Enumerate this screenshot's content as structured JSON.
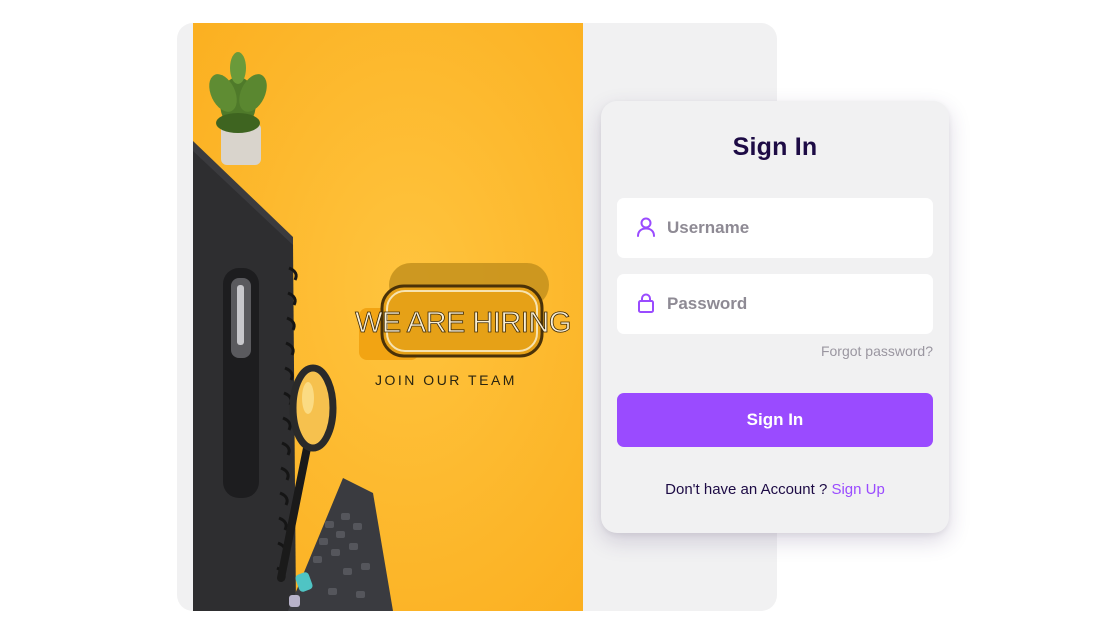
{
  "hero": {
    "headline": "WE ARE HIRING",
    "tagline": "JOIN OUR TEAM"
  },
  "login": {
    "title": "Sign In",
    "username_placeholder": "Username",
    "password_placeholder": "Password",
    "forgot_label": "Forgot password?",
    "submit_label": "Sign In",
    "signup_prompt": "Don't have an Account ?",
    "signup_link": "Sign Up"
  },
  "colors": {
    "accent": "#9a4bff",
    "title": "#1d0b45",
    "hero_yellow": "#fdb92c",
    "card_bg": "#f1f1f2"
  },
  "icons": {
    "username": "user-icon",
    "password": "lock-icon"
  }
}
